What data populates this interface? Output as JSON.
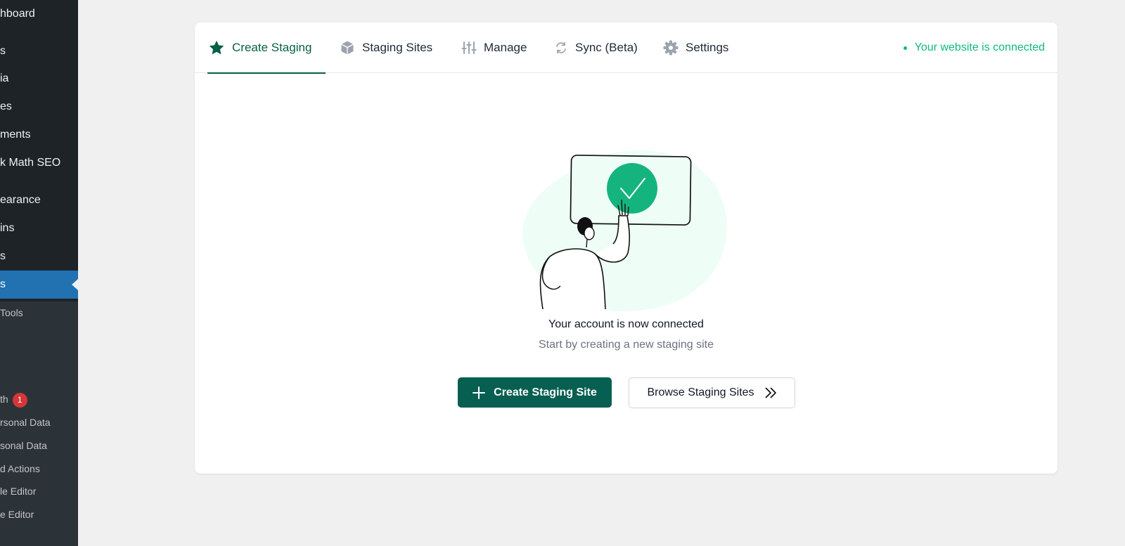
{
  "sidebar": {
    "items": [
      {
        "label": "hboard"
      },
      {
        "label": "s"
      },
      {
        "label": "ia"
      },
      {
        "label": "es"
      },
      {
        "label": "ments"
      },
      {
        "label": "k Math SEO"
      },
      {
        "label": "earance"
      },
      {
        "label": "ins"
      },
      {
        "label": "s"
      },
      {
        "label": "s",
        "active": true
      }
    ],
    "sub_items": [
      {
        "label": " Tools"
      },
      {
        "label": "th"
      },
      {
        "label": "rsonal Data"
      },
      {
        "label": "sonal Data"
      },
      {
        "label": "d Actions"
      },
      {
        "label": "le Editor"
      },
      {
        "label": "e Editor"
      }
    ],
    "badge_count": "1"
  },
  "tabs": [
    {
      "label": "Create Staging",
      "icon": "star-icon",
      "active": true
    },
    {
      "label": "Staging Sites",
      "icon": "cube-icon"
    },
    {
      "label": "Manage",
      "icon": "sliders-icon"
    },
    {
      "label": "Sync (Beta)",
      "icon": "sync-icon"
    },
    {
      "label": "Settings",
      "icon": "gear-icon"
    }
  ],
  "status": {
    "text": "Your website is connected",
    "color": "#10b981"
  },
  "main": {
    "title": "Your account is now connected",
    "subtitle": "Start by creating a new staging site",
    "primary_button": "Create Staging Site",
    "secondary_button": "Browse Staging Sites"
  },
  "colors": {
    "accent": "#065f51",
    "sidebar_bg": "#1d2327",
    "active_menu": "#2271b1",
    "success": "#10b981"
  }
}
